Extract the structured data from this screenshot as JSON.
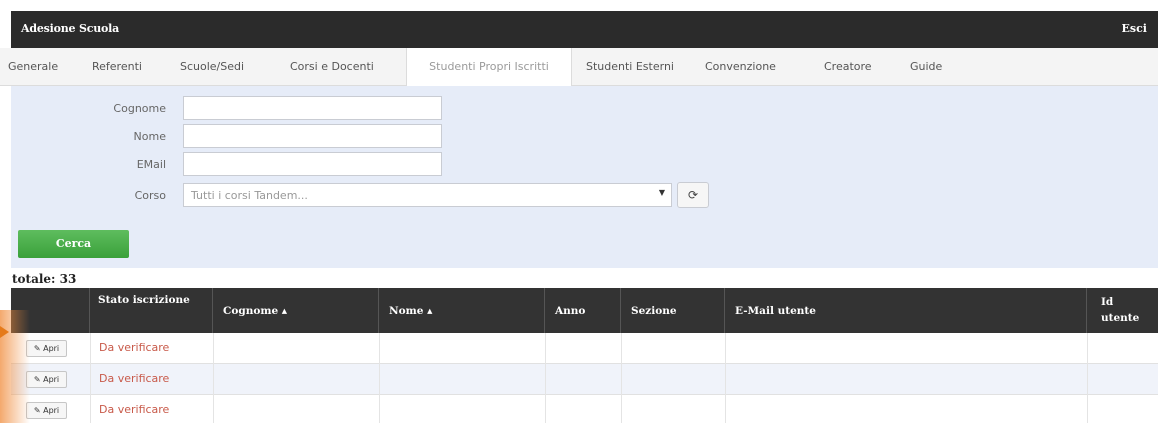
{
  "header": {
    "title": "Adesione Scuola",
    "logout_label": "Esci"
  },
  "tabs": [
    {
      "label": "Generale",
      "active": false
    },
    {
      "label": "Referenti",
      "active": false
    },
    {
      "label": "Scuole/Sedi",
      "active": false
    },
    {
      "label": "Corsi e Docenti",
      "active": false
    },
    {
      "label": "Studenti Propri Iscritti",
      "active": true
    },
    {
      "label": "Studenti Esterni",
      "active": false
    },
    {
      "label": "Convenzione",
      "active": false
    },
    {
      "label": "Creatore",
      "active": false
    },
    {
      "label": "Guide",
      "active": false
    }
  ],
  "filters": {
    "surname_label": "Cognome",
    "surname_value": "",
    "name_label": "Nome",
    "name_value": "",
    "email_label": "EMail",
    "email_value": "",
    "course_label": "Corso",
    "course_selected": "Tutti i corsi Tandem...",
    "search_label": "Cerca",
    "refresh_icon": "refresh-icon"
  },
  "results": {
    "total_label": "totale: 33",
    "columns": [
      {
        "label": "",
        "sortable": false
      },
      {
        "label": "Stato iscrizione",
        "sortable": false
      },
      {
        "label": "Cognome",
        "sortable": true
      },
      {
        "label": "Nome",
        "sortable": true
      },
      {
        "label": "Anno",
        "sortable": false
      },
      {
        "label": "Sezione",
        "sortable": false
      },
      {
        "label": "E-Mail utente",
        "sortable": false
      },
      {
        "label": "Id\nutente",
        "sortable": false
      }
    ],
    "sort_indicator": "▴",
    "open_label": "Apri",
    "rows": [
      {
        "status": "Da verificare",
        "surname": "",
        "name": "",
        "year": "",
        "section": "",
        "email": "",
        "id": ""
      },
      {
        "status": "Da verificare",
        "surname": "",
        "name": "",
        "year": "",
        "section": "",
        "email": "",
        "id": ""
      },
      {
        "status": "Da verificare",
        "surname": "",
        "name": "",
        "year": "",
        "section": "",
        "email": "",
        "id": ""
      }
    ]
  },
  "colors": {
    "header_bg": "#2b2b2b",
    "panel_bg": "#e6ecf8",
    "search_button": "#3aa13a",
    "status_text": "#c85a4a",
    "marker": "#e57a1a"
  }
}
